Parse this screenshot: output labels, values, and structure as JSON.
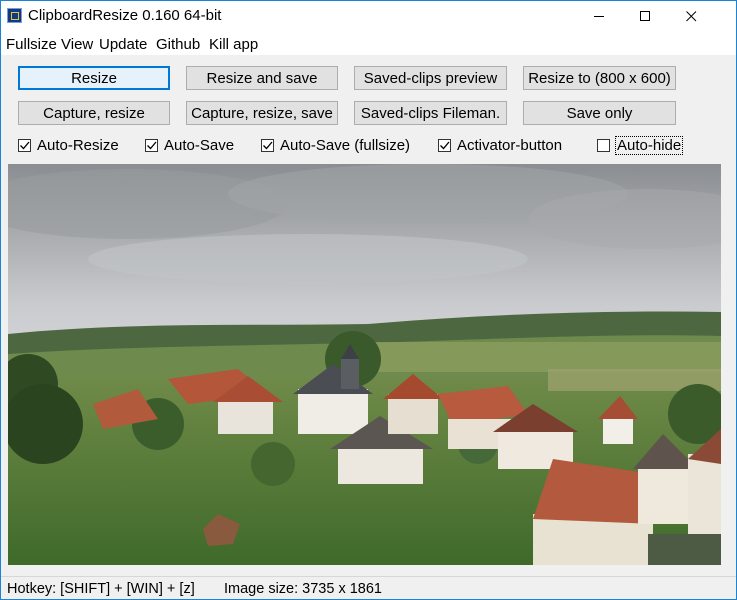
{
  "window": {
    "title": "ClipboardResize 0.160 64-bit",
    "controls": {
      "minimize": "minimize-icon",
      "maximize": "maximize-icon",
      "close": "close-icon"
    }
  },
  "menu": {
    "items": [
      "Fullsize View",
      "Update",
      "Github",
      "Kill app"
    ]
  },
  "buttons": {
    "row1": [
      "Resize",
      "Resize and save",
      "Saved-clips preview",
      "Resize to (800 x 600)"
    ],
    "row2": [
      "Capture, resize",
      "Capture, resize, save",
      "Saved-clips Fileman.",
      "Save only"
    ]
  },
  "checkboxes": [
    {
      "label": "Auto-Resize",
      "checked": true
    },
    {
      "label": "Auto-Save",
      "checked": true
    },
    {
      "label": "Auto-Save (fullsize)",
      "checked": true
    },
    {
      "label": "Activator-button",
      "checked": true
    },
    {
      "label": "Auto-hide",
      "checked": false
    }
  ],
  "status": {
    "hotkey": "Hotkey: [SHIFT] + [WIN] + [z]",
    "image_size": "Image size: 3735 x 1861"
  },
  "colors": {
    "accent": "#0078d7",
    "window_border": "#1883d7"
  }
}
